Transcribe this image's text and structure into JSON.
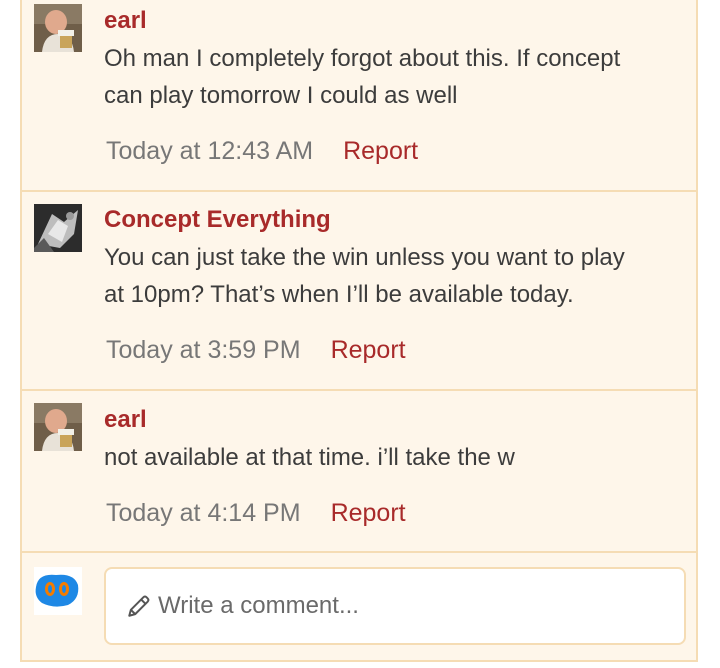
{
  "comments": [
    {
      "author": "earl",
      "text": "Oh man I completely forgot about this. If concept can play tomorrow I could as well",
      "text_line1": "Oh man I completely forgot about this. If concept",
      "text_line2": "can play tomorrow I could as well",
      "time": "Today at 12:43 AM",
      "report_label": "Report",
      "avatar": "earl-avatar-photo"
    },
    {
      "author": "Concept Everything",
      "text_line1": "You can just take the win unless you want to play",
      "text_line2": "at 10pm? That’s when I’ll be available today.",
      "time": "Today at 3:59 PM",
      "report_label": "Report",
      "avatar": "concept-avatar-photo"
    },
    {
      "author": "earl",
      "text_line1": "not available at that time. i’ll take the w",
      "time": "Today at 4:14 PM",
      "report_label": "Report",
      "avatar": "earl-avatar-photo"
    }
  ],
  "composer": {
    "placeholder": "Write a comment...",
    "icon": "pencil-icon",
    "avatar": "own-avatar-blue-orange"
  },
  "colors": {
    "accent": "#a82a2a",
    "thread_bg": "#fef6ea",
    "border": "#f5dcb4",
    "text": "#3c3c3c",
    "muted": "#777777"
  }
}
